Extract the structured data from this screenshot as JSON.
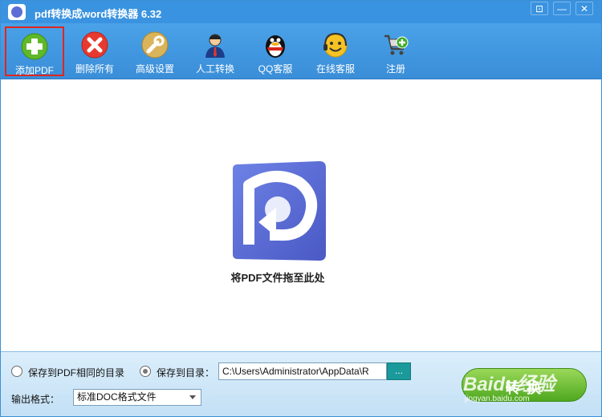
{
  "window": {
    "title": "pdf转换成word转换器 6.32",
    "buttons": [
      "⊡",
      "—",
      "✕"
    ]
  },
  "toolbar": {
    "items": [
      {
        "label": "添加PDF",
        "icon": "add-plus-icon",
        "selected": true
      },
      {
        "label": "删除所有",
        "icon": "delete-x-icon"
      },
      {
        "label": "高级设置",
        "icon": "wrench-icon"
      },
      {
        "label": "人工转换",
        "icon": "person-icon"
      },
      {
        "label": "QQ客服",
        "icon": "qq-penguin-icon"
      },
      {
        "label": "在线客服",
        "icon": "headset-smiley-icon"
      },
      {
        "label": "注册",
        "icon": "cart-plus-icon"
      }
    ]
  },
  "main": {
    "drop_text": "将PDF文件拖至此处"
  },
  "bottom": {
    "radio_same_dir": "保存到PDF相同的目录",
    "radio_custom_dir": "保存到目录：",
    "path_value": "C:\\Users\\Administrator\\AppData\\R",
    "browse_label": "...",
    "format_label": "输出格式：",
    "format_value": "标准DOC格式文件",
    "convert_label": "转换"
  },
  "watermark": {
    "logo": "Baidu经验",
    "url": "jingyan.baidu.com"
  },
  "colors": {
    "titlebar": "#3a93e0",
    "toolbar": "#4aa2e8",
    "accent_green": "#4fa81f",
    "selected_border": "#e0251f",
    "logo_blue": "#5b6fd6"
  }
}
